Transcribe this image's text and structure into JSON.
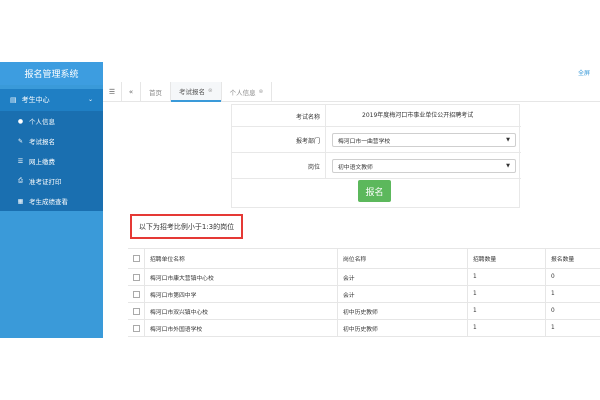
{
  "fullscreen_label": "全屏",
  "sidebar": {
    "brand": "报名管理系统",
    "group": {
      "label": "考生中心",
      "icon": "id-card-icon"
    },
    "items": [
      {
        "label": "个人信息",
        "icon": "user-icon"
      },
      {
        "label": "考试报名",
        "icon": "edit-icon"
      },
      {
        "label": "网上缴费",
        "icon": "list-icon"
      },
      {
        "label": "准考证打印",
        "icon": "printer-icon"
      },
      {
        "label": "考生成绩查看",
        "icon": "table-icon"
      }
    ]
  },
  "topbar": {
    "tabs": [
      {
        "label": "首页",
        "closable": false
      },
      {
        "label": "考试报名",
        "closable": true,
        "active": true
      },
      {
        "label": "个人信息",
        "closable": true
      }
    ]
  },
  "form": {
    "exam_name_label": "考试名称",
    "exam_name_value": "2019年度梅河口市事业单位公开招聘考试",
    "department_label": "报考部门",
    "department_value": "梅河口市一曲营学校",
    "position_label": "岗位",
    "position_value": "初中语文教师",
    "submit_label": "报名"
  },
  "notice": "以下为招考比例小于1:3的岗位",
  "table": {
    "headers": [
      "招聘单位名称",
      "岗位名称",
      "招聘数量",
      "报名数量"
    ],
    "rows": [
      [
        "梅河口市康大营镇中心校",
        "会计",
        "1",
        "0"
      ],
      [
        "梅河口市第四中学",
        "会计",
        "1",
        "1"
      ],
      [
        "梅河口市双兴镇中心校",
        "初中历史教师",
        "1",
        "0"
      ],
      [
        "梅河口市外国语学校",
        "初中历史教师",
        "1",
        "1"
      ]
    ]
  }
}
